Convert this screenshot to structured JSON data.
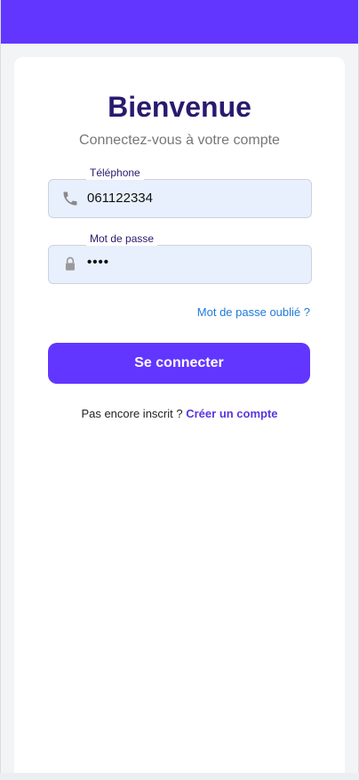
{
  "login": {
    "title": "Bienvenue",
    "subtitle": "Connectez-vous à votre compte",
    "phone": {
      "label": "Téléphone",
      "value": "061122334",
      "icon": "phone-icon"
    },
    "password": {
      "label": "Mot de passe",
      "value": "••••",
      "icon": "lock-icon"
    },
    "forgot_label": "Mot de passe oublié ?",
    "submit_label": "Se connecter",
    "signup_prompt": "Pas encore inscrit ?",
    "signup_link": "Créer un compte"
  },
  "colors": {
    "brand": "#6236ff",
    "title": "#2a1a6e",
    "link": "#1f7ad9",
    "field_bg": "#e8f0fd"
  }
}
